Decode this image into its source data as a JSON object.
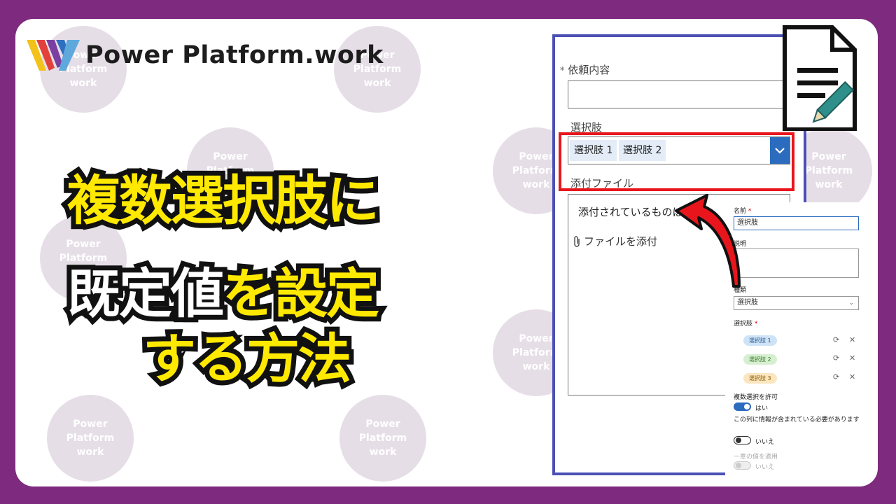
{
  "brand": {
    "name": "Power Platform.work"
  },
  "watermark": {
    "lines": "Power\nPlatform\nwork"
  },
  "title": {
    "line1": "複数選択肢に",
    "line2a": "既定値",
    "line2b": "を設定",
    "line3": "する方法"
  },
  "form": {
    "request_label": "依頼内容",
    "required_mark": "*",
    "choice_label": "選択肢",
    "chips": [
      "選択肢 1",
      "選択肢 2"
    ],
    "attach_label": "添付ファイル",
    "attach_text": "添付されているものは",
    "attach_button": "ファイルを添付"
  },
  "settings": {
    "name_label": "名前",
    "name_value": "選択肢",
    "desc_label": "説明",
    "type_label": "種類",
    "type_value": "選択肢",
    "choices_label": "選択肢",
    "choices": [
      {
        "label": "選択肢 1",
        "color": "#cfe3f7",
        "text_color": "#2b5d8f"
      },
      {
        "label": "選択肢 2",
        "color": "#d6efd0",
        "text_color": "#3b7a2a"
      },
      {
        "label": "選択肢 3",
        "color": "#fbe6bf",
        "text_color": "#8a5a00"
      }
    ],
    "multi_label": "複数選択を許可",
    "multi_value": "はい",
    "required_label": "この列に情報が含まれている必要があります",
    "required_value": "いいえ",
    "unique_label": "一意の値を適用",
    "unique_value": "いいえ"
  },
  "colors": {
    "background": "#7e2a7e",
    "accent_blue": "#2b6cbf",
    "highlight_red": "#e8161c",
    "title_yellow": "#ffe900"
  }
}
